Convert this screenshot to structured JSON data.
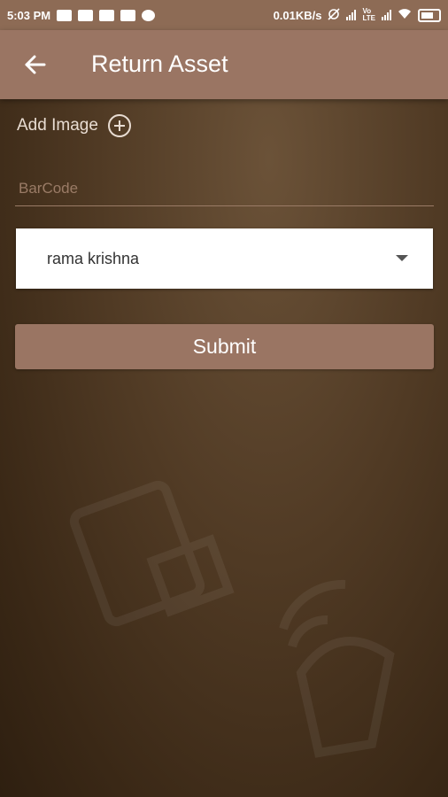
{
  "status_bar": {
    "time": "5:03 PM",
    "speed": "0.01KB/s",
    "left_icons": [
      "chat-icon",
      "chat-icon",
      "sms-icon",
      "youtube-icon",
      "cloud-icon"
    ],
    "right_icons": [
      "alarm-off-icon",
      "signal-icon",
      "volte-icon",
      "signal-icon",
      "wifi-icon",
      "battery-charging-icon"
    ]
  },
  "app_bar": {
    "title": "Return Asset",
    "back_icon": "arrow-left-icon"
  },
  "form": {
    "add_image_label": "Add Image",
    "add_image_icon": "plus-circle-icon",
    "barcode_placeholder": "BarCode",
    "barcode_value": "",
    "user_select_value": "rama krishna",
    "submit_label": "Submit"
  },
  "colors": {
    "app_bar": "#9a7563",
    "status_bar": "#8d6b55",
    "background": "#503a24",
    "accent_text": "#e8dcd2"
  }
}
